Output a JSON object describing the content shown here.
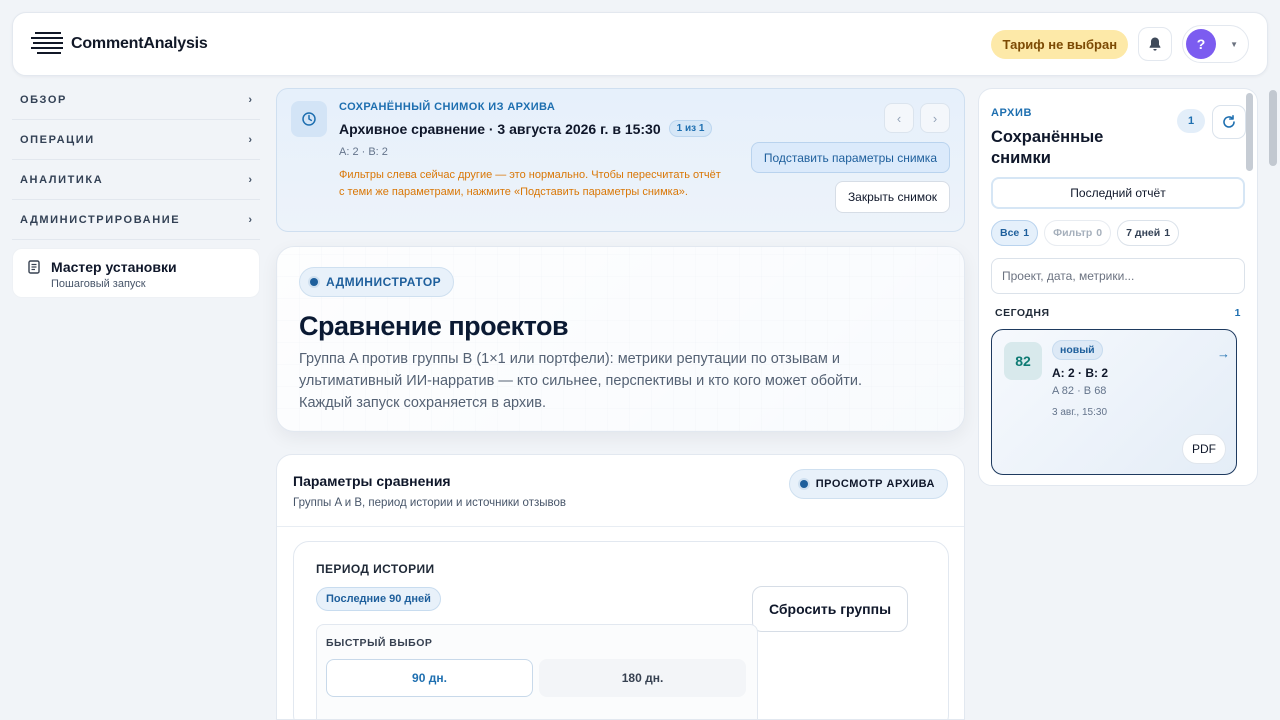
{
  "header": {
    "brand": "CommentAnalysis",
    "tariff_label": "Тариф не выбран",
    "avatar_letter": "?"
  },
  "sidebar": {
    "items": [
      {
        "label": "ОБЗОР",
        "chevron": "›"
      },
      {
        "label": "ОПЕРАЦИИ",
        "chevron": "›"
      },
      {
        "label": "АНАЛИТИКА",
        "chevron": "›"
      },
      {
        "label": "АДМИНИСТРИРОВАНИЕ",
        "chevron": "›"
      }
    ],
    "wizard": {
      "title": "Мастер установки",
      "subtitle": "Пошаговый запуск"
    }
  },
  "snapshot": {
    "kicker": "СОХРАНЁННЫЙ СНИМОК ИЗ АРХИВА",
    "title": "Архивное сравнение · 3 августа 2026 г. в 15:30",
    "counter": "1 из 1",
    "groups": "A: 2 · B: 2",
    "warning": "Фильтры слева сейчас другие — это нормально. Чтобы пересчитать отчёт с теми же параметрами, нажмите «Подставить параметры снимка».",
    "prev": "‹",
    "next": "›",
    "apply_label": "Подставить параметры снимка",
    "close_label": "Закрыть снимок"
  },
  "hero": {
    "role": "АДМИНИСТРАТОР",
    "title": "Сравнение проектов",
    "description": "Группа A против группы B (1×1 или портфели): метрики репутации по отзывам и ультимативный ИИ-нарратив — кто сильнее, перспективы и кто кого может обойти. Каждый запуск сохраняется в архив."
  },
  "params": {
    "title": "Параметры сравнения",
    "subtitle": "Группы A и B, период истории и источники отзывов",
    "mode": "ПРОСМОТР АРХИВА",
    "period_title": "ПЕРИОД ИСТОРИИ",
    "period_value": "Последние 90 дней",
    "reset_label": "Сбросить группы",
    "quick_title": "БЫСТРЫЙ ВЫБОР",
    "quick_options": [
      "90 дн.",
      "180 дн."
    ]
  },
  "archive": {
    "kicker": "АРХИВ",
    "title": "Сохранённые снимки",
    "count": "1",
    "last_report_label": "Последний отчёт",
    "filters": [
      {
        "label": "Все",
        "count": "1"
      },
      {
        "label": "Фильтр",
        "count": "0"
      },
      {
        "label": "7 дней",
        "count": "1"
      }
    ],
    "search_placeholder": "Проект, дата, метрики...",
    "today_label": "СЕГОДНЯ",
    "today_count": "1",
    "card": {
      "score": "82",
      "badge": "новый",
      "groups": "A: 2 · B: 2",
      "scores": "A 82 · B 68",
      "date": "3 авг., 15:30",
      "arrow": "→",
      "pdf_label": "PDF"
    }
  },
  "colors": {
    "accent": "#1e6fb0",
    "tariff_bg": "#fde9a8",
    "avatar": "#7c5cf0",
    "warning": "#d97706",
    "score": "#0f7b74"
  }
}
